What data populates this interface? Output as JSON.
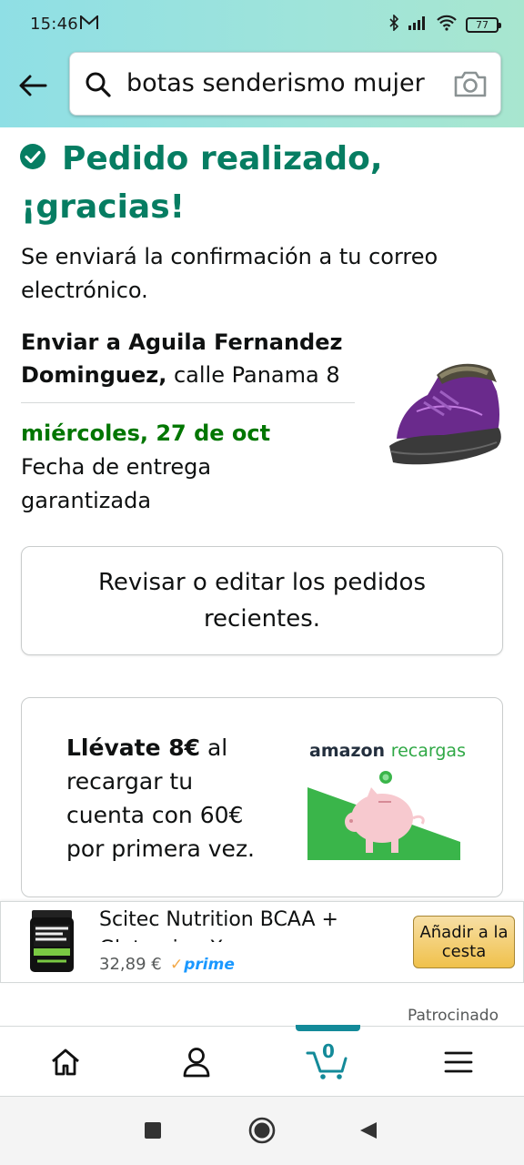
{
  "status_bar": {
    "time": "15:46",
    "battery": "77"
  },
  "search": {
    "query": "botas senderismo mujer"
  },
  "confirmation": {
    "title": "Pedido realizado, ¡gracias!",
    "subtitle": "Se enviará la confirmación a tu correo electrónico.",
    "ship_to_prefix": "Enviar a Aguila Fernandez Dominguez,",
    "ship_to_address": " calle Panama 8",
    "delivery_date": "miércoles, 27 de oct",
    "delivery_note": "Fecha de entrega garantizada"
  },
  "review_button": {
    "label": "Revisar o editar los pedidos recientes."
  },
  "promo": {
    "bold": "Llévate 8€",
    "rest": " al recargar tu cuenta con 60€ por primera vez.",
    "brand_amazon": "amazon",
    "brand_recargas": "recargas"
  },
  "ad": {
    "title": "Scitec Nutrition BCAA + Glutamine Xpress",
    "price": "32,89 €",
    "prime": "prime",
    "add_to_cart": "Añadir a la cesta",
    "sponsored": "Patrocinado"
  },
  "bottom_nav": {
    "cart_count": "0"
  },
  "colors": {
    "success_green": "#067d62",
    "delivery_green": "#007600",
    "accent_teal": "#138a99",
    "button_yellow": "#f0c14b"
  }
}
